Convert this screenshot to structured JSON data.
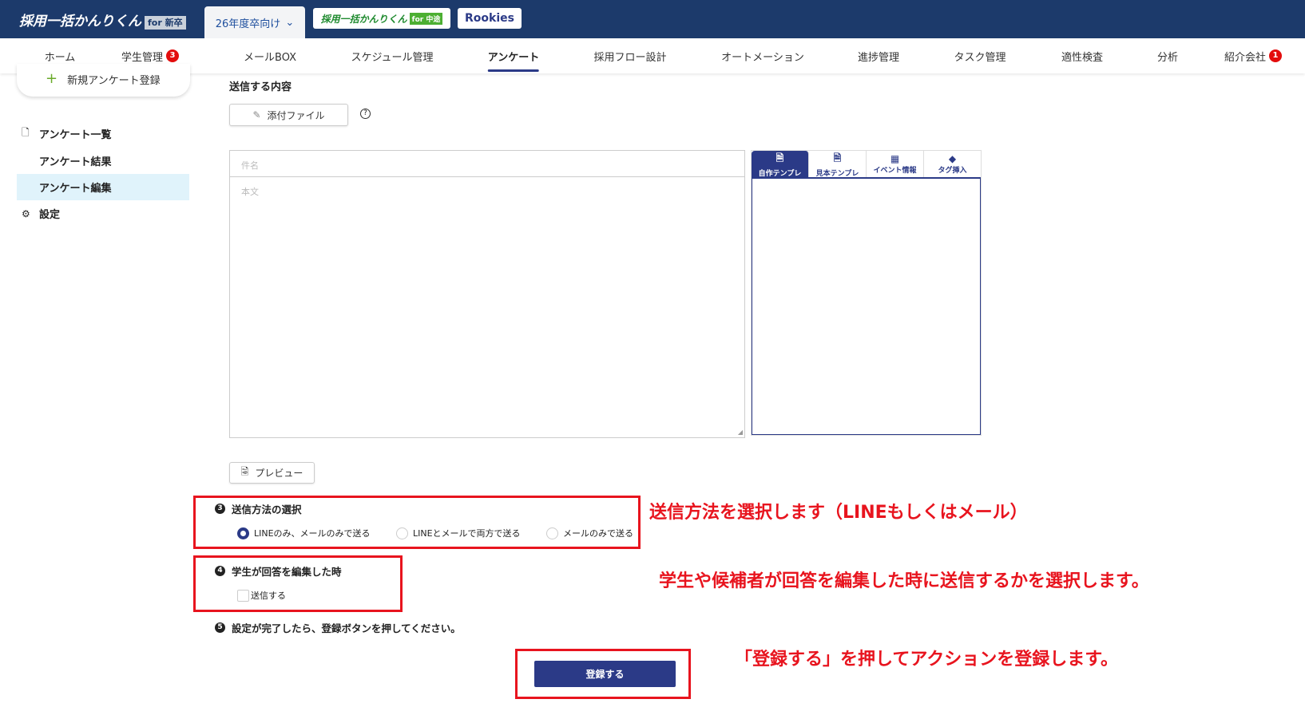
{
  "header": {
    "logo_main": "採用一括かんりくん",
    "logo_for": "for 新卒",
    "year_select": "26年度卒向け",
    "logo_mid": "採用一括かんりくん",
    "logo_mid_for": "for 中途",
    "rookies": "Rookies"
  },
  "nav": [
    {
      "label": "ホーム"
    },
    {
      "label": "学生管理",
      "badge": "3"
    },
    {
      "label": "メールBOX"
    },
    {
      "label": "スケジュール管理"
    },
    {
      "label": "アンケート",
      "active": true
    },
    {
      "label": "採用フロー設計"
    },
    {
      "label": "オートメーション"
    },
    {
      "label": "進捗管理"
    },
    {
      "label": "タスク管理"
    },
    {
      "label": "適性検査"
    },
    {
      "label": "分析"
    },
    {
      "label": "紹介会社",
      "badge": "1"
    }
  ],
  "sidebar": {
    "new_button": "新規アンケート登録",
    "items": [
      {
        "label": "アンケート一覧"
      },
      {
        "label": "アンケート結果"
      },
      {
        "label": "アンケート編集"
      },
      {
        "label": "設定"
      }
    ]
  },
  "main": {
    "section_title": "送信する内容",
    "attach_label": "添付ファイル",
    "subject_placeholder": "件名",
    "body_placeholder": "本文",
    "template_tabs": [
      "自作テンプレ",
      "見本テンプレ",
      "イベント情報",
      "タグ挿入"
    ],
    "preview_label": "プレビュー",
    "step3": {
      "num": "3",
      "title": "送信方法の選択",
      "options": [
        "LINEのみ、メールのみで送る",
        "LINEとメールで両方で送る",
        "メールのみで送る"
      ],
      "selected": 0
    },
    "step4": {
      "num": "4",
      "title": "学生が回答を編集した時",
      "checkbox": "送信する",
      "checked": false
    },
    "step5": {
      "num": "5",
      "title": "設定が完了したら、登録ボタンを押してください。"
    },
    "submit_label": "登録する"
  },
  "annotations": [
    "送信方法を選択します（LINEもしくはメール）",
    "学生や候補者が回答を編集した時に送信するかを選択します。",
    "「登録する」を押してアクションを登録します。"
  ],
  "colors": {
    "header": "#1c3a6b",
    "accent": "#2b3a87",
    "annotation": "#e8141e"
  }
}
